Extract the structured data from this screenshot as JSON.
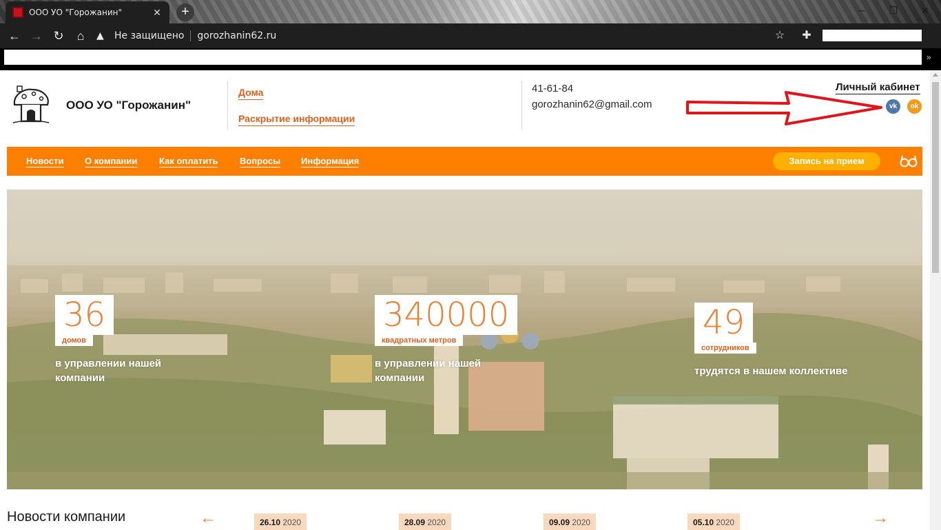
{
  "browser": {
    "tab_title": "ООО УО \"Горожанин\"",
    "tab_close": "✕",
    "new_tab": "+",
    "security_text": "Не защищено",
    "url": "gorozhanin62.ru",
    "win_min": "─",
    "win_max": "❐",
    "win_close": "✕",
    "bookmarks_more": "»"
  },
  "header": {
    "company_name": "ООО УО \"Горожанин\"",
    "links": [
      "Дома",
      "Раскрытие информации"
    ],
    "phone": "41-61-84",
    "email": "gorozhanin62@gmail.com",
    "cabinet": "Личный кабинет",
    "social": [
      {
        "name": "vk",
        "glyph": "vk",
        "color": "#4f78a8"
      },
      {
        "name": "odnoklassniki",
        "glyph": "ok",
        "color": "#f29a1a"
      }
    ]
  },
  "nav": {
    "items": [
      "Новости",
      "О компании",
      "Как оплатить",
      "Вопросы",
      "Информация"
    ],
    "appointment": "Запись на прием",
    "accent": "#ff7f00"
  },
  "stats": [
    {
      "number": "36",
      "tag": "домов",
      "text_lines": [
        "в управлении нашей",
        "компании"
      ]
    },
    {
      "number": "340000",
      "tag": "квадратных метров",
      "text_lines": [
        "в управлении нашей",
        "компании"
      ]
    },
    {
      "number": "49",
      "tag": "сотрудников",
      "text_lines": [
        "трудятся в нашем коллективе"
      ]
    }
  ],
  "news": {
    "title": "Новости компании",
    "prev": "←",
    "next": "→",
    "items": [
      {
        "day": "26.10",
        "year": "2020"
      },
      {
        "day": "28.09",
        "year": "2020"
      },
      {
        "day": "09.09",
        "year": "2020"
      },
      {
        "day": "05.10",
        "year": "2020"
      }
    ]
  }
}
